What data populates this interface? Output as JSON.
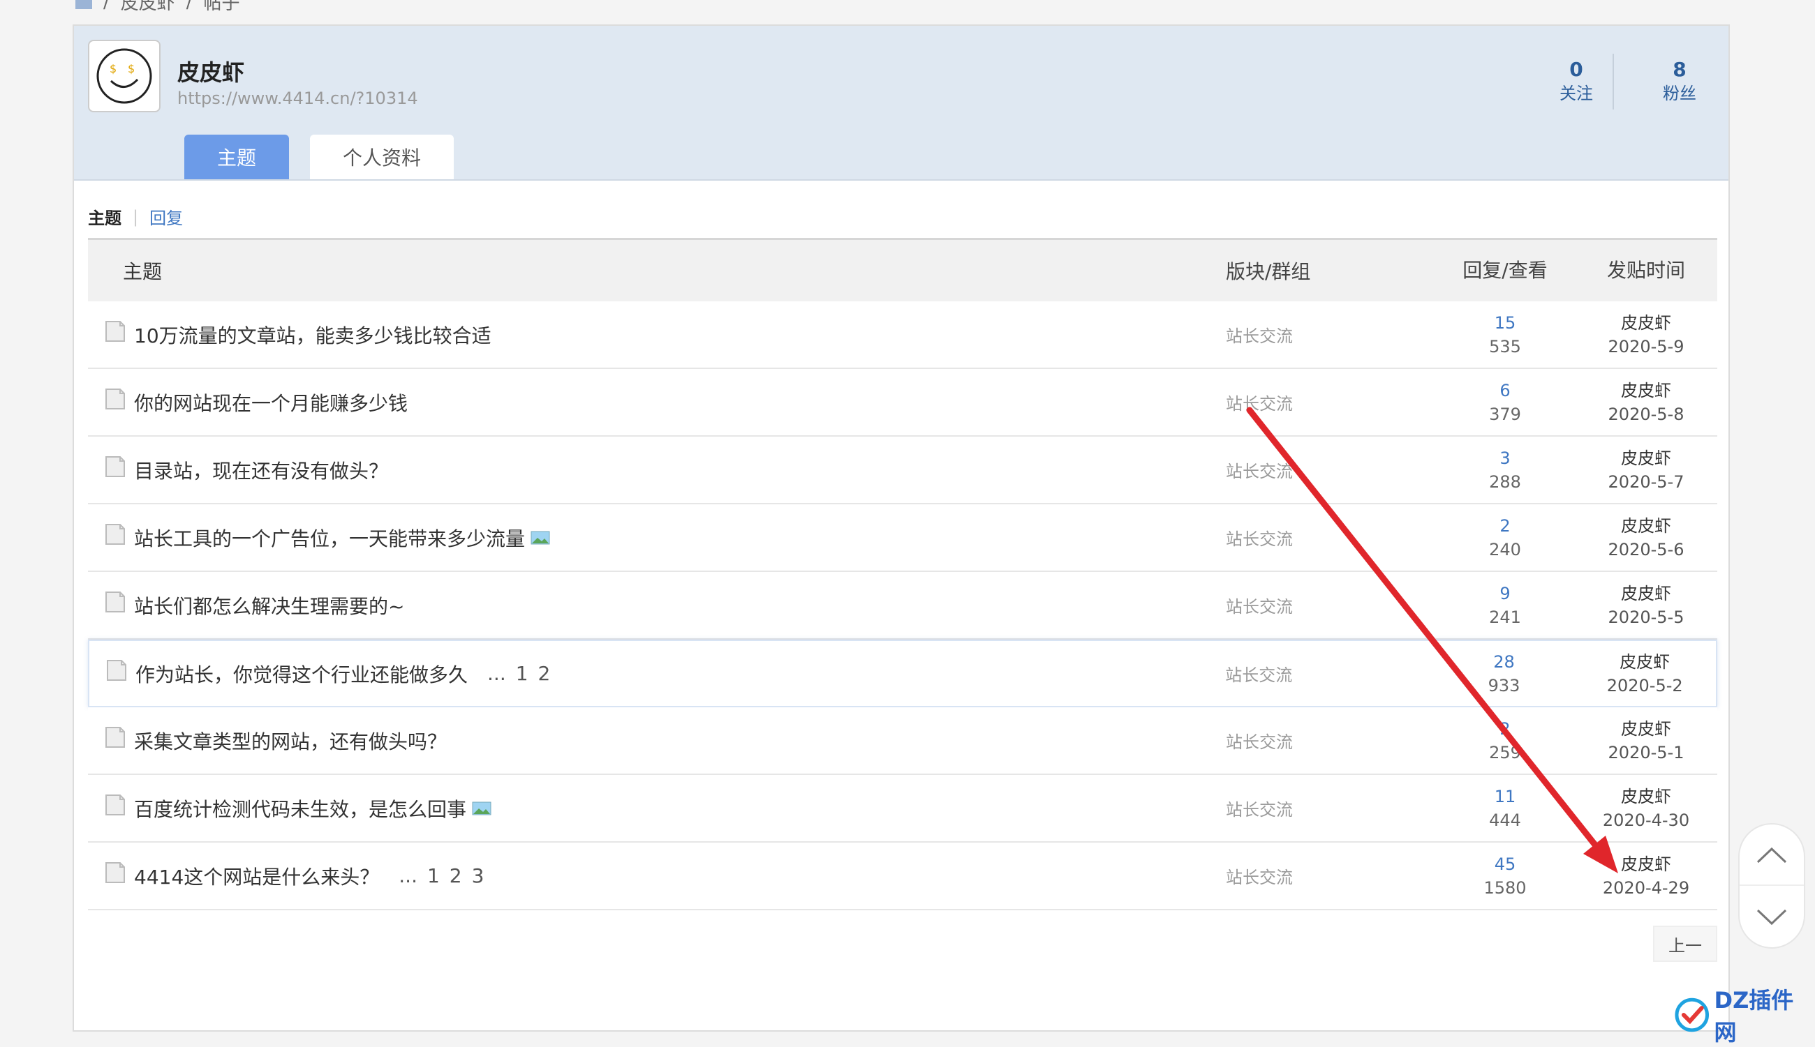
{
  "breadcrumb": [
    "皮皮虾",
    "帖子"
  ],
  "profile": {
    "name": "皮皮虾",
    "url": "https://www.4414.cn/?10314",
    "stats": [
      {
        "num": "0",
        "label": "关注"
      },
      {
        "num": "8",
        "label": "粉丝"
      }
    ]
  },
  "tabs": [
    "主题",
    "个人资料"
  ],
  "subnav": {
    "active": "主题",
    "other": "回复"
  },
  "table": {
    "headers": {
      "topic": "主题",
      "forum": "版块/群组",
      "stats": "回复/查看",
      "time": "发贴时间"
    },
    "rows": [
      {
        "title": "10万流量的文章站，能卖多少钱比较合适",
        "forum": "站长交流",
        "replies": "15",
        "views": "535",
        "author": "皮皮虾",
        "date": "2020-5-9"
      },
      {
        "title": "你的网站现在一个月能赚多少钱",
        "forum": "站长交流",
        "replies": "6",
        "views": "379",
        "author": "皮皮虾",
        "date": "2020-5-8"
      },
      {
        "title": "目录站，现在还有没有做头？",
        "forum": "站长交流",
        "replies": "3",
        "views": "288",
        "author": "皮皮虾",
        "date": "2020-5-7"
      },
      {
        "title": "站长工具的一个广告位，一天能带来多少流量",
        "has_image": true,
        "forum": "站长交流",
        "replies": "2",
        "views": "240",
        "author": "皮皮虾",
        "date": "2020-5-6"
      },
      {
        "title": "站长们都怎么解决生理需要的~",
        "forum": "站长交流",
        "replies": "9",
        "views": "241",
        "author": "皮皮虾",
        "date": "2020-5-5"
      },
      {
        "title": "作为站长，你觉得这个行业还能做多久",
        "pages": [
          "...",
          "1",
          "2"
        ],
        "forum": "站长交流",
        "replies": "28",
        "views": "933",
        "author": "皮皮虾",
        "date": "2020-5-2",
        "highlight": true
      },
      {
        "title": "采集文章类型的网站，还有做头吗？",
        "forum": "站长交流",
        "replies": "2",
        "views": "259",
        "author": "皮皮虾",
        "date": "2020-5-1"
      },
      {
        "title": "百度统计检测代码未生效，是怎么回事",
        "has_image": true,
        "forum": "站长交流",
        "replies": "11",
        "views": "444",
        "author": "皮皮虾",
        "date": "2020-4-30"
      },
      {
        "title": "4414这个网站是什么来头？",
        "pages": [
          "...",
          "1",
          "2",
          "3"
        ],
        "forum": "站长交流",
        "replies": "45",
        "views": "1580",
        "author": "皮皮虾",
        "date": "2020-4-29"
      }
    ]
  },
  "pagination": {
    "prev_label": "上一"
  },
  "watermark": {
    "text": "DZ插件网"
  },
  "colors": {
    "accent": "#6c9be8",
    "link": "#3f77c2",
    "header_bg": "#dfe8f2",
    "annotation_arrow": "#e0262b"
  }
}
